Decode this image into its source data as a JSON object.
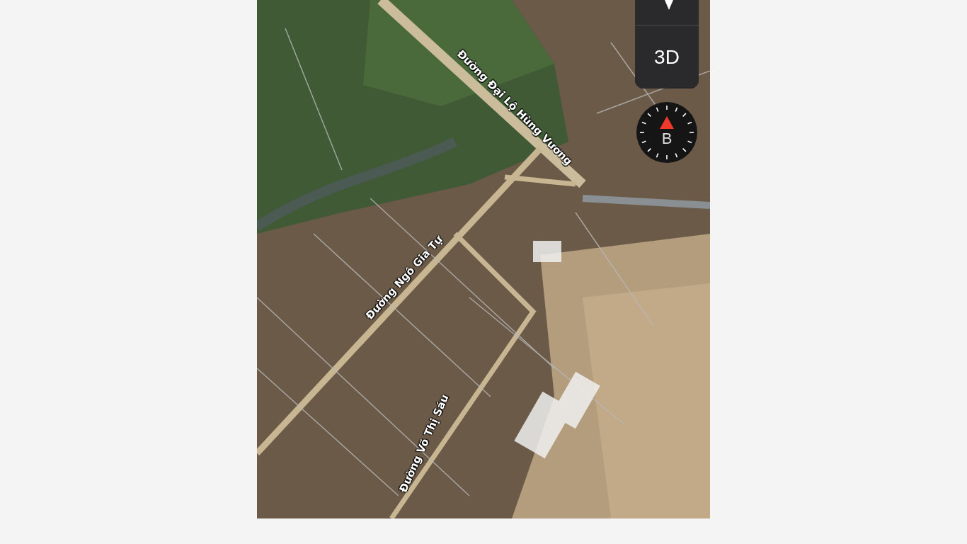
{
  "map": {
    "road_labels": [
      "Đường Đại Lộ Hùng Vương",
      "Đường Ngô Gia Tự",
      "Đường Võ Thị Sáu"
    ]
  },
  "controls": {
    "view_button": "3D",
    "compass_letter": "B"
  }
}
